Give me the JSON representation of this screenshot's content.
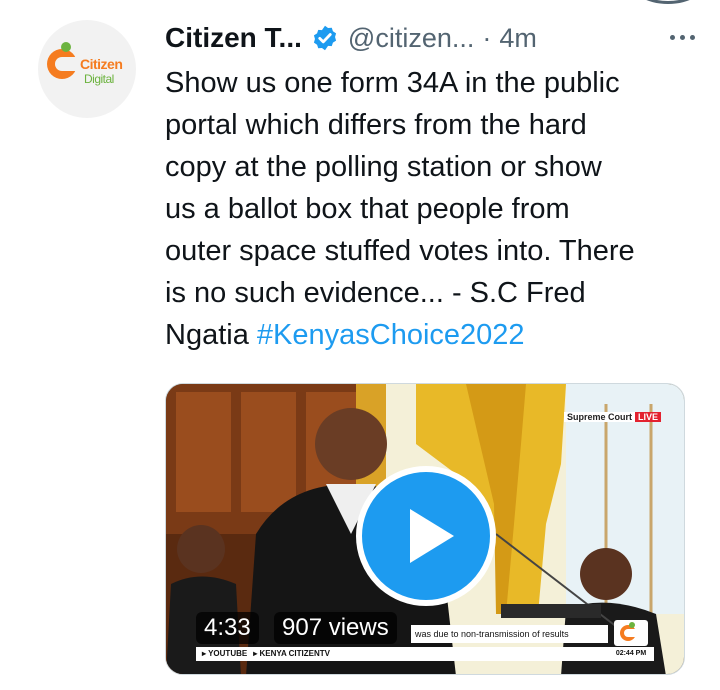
{
  "account": {
    "avatar_logo_line1": "Citizen",
    "avatar_logo_line2": "Digital",
    "display_name": "Citizen T...",
    "handle": "@citizen...",
    "separator": "·",
    "timestamp": "4m",
    "verified_icon": "verified-badge-icon",
    "more_icon": "more-options-icon"
  },
  "tweet": {
    "lines": [
      "Show us one form 34A in the public",
      "portal which differs from the hard",
      "copy at the polling station or show",
      "us a ballot box that people from",
      "outer space stuffed votes into. There",
      "is no such evidence... - S.C Fred"
    ],
    "last_line_prefix": "Ngatia ",
    "hashtag": "#KenyasChoice2022"
  },
  "video": {
    "duration": "4:33",
    "views": "907 views",
    "play_icon": "play-icon",
    "broadcast_label": "Supreme Court",
    "live_label": "LIVE",
    "ticker_text": "was due to non-transmission of results",
    "bottom_youtube": "▸ YOUTUBE",
    "bottom_channel": "▸ KENYA CITIZENTV",
    "clock": "02:44 PM"
  },
  "colors": {
    "accent": "#1d9bf0",
    "secondary_text": "#536471",
    "brand_orange": "#f57c20",
    "brand_green": "#6cb33f"
  }
}
